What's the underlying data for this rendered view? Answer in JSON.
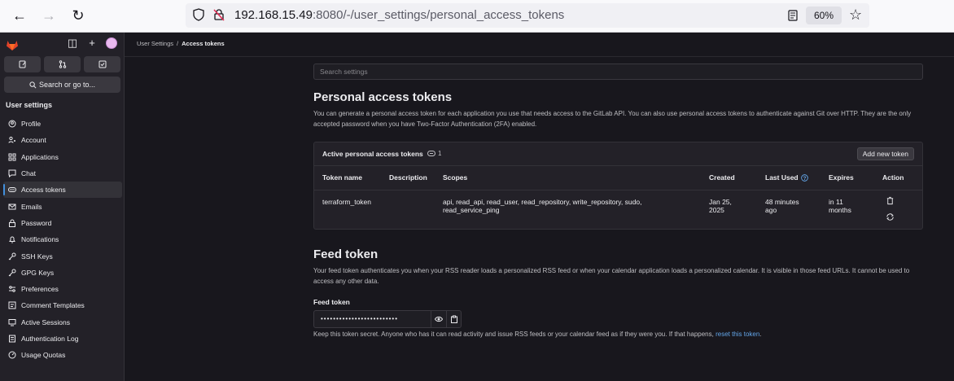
{
  "browser": {
    "url_host": "192.168.15.49",
    "url_rest": ":8080/-/user_settings/personal_access_tokens",
    "zoom": "60%"
  },
  "sidebar": {
    "search_label": "Search or go to...",
    "heading": "User settings",
    "items": [
      {
        "label": "Profile",
        "icon": "profile-icon"
      },
      {
        "label": "Account",
        "icon": "account-icon"
      },
      {
        "label": "Applications",
        "icon": "applications-icon"
      },
      {
        "label": "Chat",
        "icon": "chat-icon"
      },
      {
        "label": "Access tokens",
        "icon": "token-icon",
        "active": true
      },
      {
        "label": "Emails",
        "icon": "mail-icon"
      },
      {
        "label": "Password",
        "icon": "lock-icon"
      },
      {
        "label": "Notifications",
        "icon": "bell-icon"
      },
      {
        "label": "SSH Keys",
        "icon": "key-icon"
      },
      {
        "label": "GPG Keys",
        "icon": "key-icon"
      },
      {
        "label": "Preferences",
        "icon": "preferences-icon"
      },
      {
        "label": "Comment Templates",
        "icon": "comment-icon"
      },
      {
        "label": "Active Sessions",
        "icon": "sessions-icon"
      },
      {
        "label": "Authentication Log",
        "icon": "log-icon"
      },
      {
        "label": "Usage Quotas",
        "icon": "quota-icon"
      }
    ]
  },
  "breadcrumb": {
    "parent": "User Settings",
    "separator": "/",
    "current": "Access tokens"
  },
  "search": {
    "placeholder": "Search settings"
  },
  "pat": {
    "title": "Personal access tokens",
    "description": "You can generate a personal access token for each application you use that needs access to the GitLab API. You can also use personal access tokens to authenticate against Git over HTTP. They are the only accepted password when you have Two-Factor Authentication (2FA) enabled."
  },
  "tokens_card": {
    "title": "Active personal access tokens",
    "count": "1",
    "add_button": "Add new token",
    "columns": [
      "Token name",
      "Description",
      "Scopes",
      "Created",
      "Last Used",
      "Expires",
      "Action"
    ],
    "rows": [
      {
        "name": "terraform_token",
        "description": "",
        "scopes_line1": "api, read_api, read_user, read_repository, write_repository, sudo,",
        "scopes_line2": "read_service_ping",
        "created_line1": "Jan 25,",
        "created_line2": "2025",
        "last_used_line1": "48 minutes",
        "last_used_line2": "ago",
        "expires_line1": "in 11",
        "expires_line2": "months"
      }
    ]
  },
  "feed": {
    "title": "Feed token",
    "description": "Your feed token authenticates you when your RSS reader loads a personalized RSS feed or when your calendar application loads a personalized calendar. It is visible in those feed URLs. It cannot be used to access any other data.",
    "label": "Feed token",
    "masked_value": "•••••••••••••••••••••••••",
    "note": "Keep this token secret. Anyone who has it can read activity and issue RSS feeds or your calendar feed as if they were you. If that happens,",
    "reset_link": "reset this token",
    "note_end": "."
  }
}
